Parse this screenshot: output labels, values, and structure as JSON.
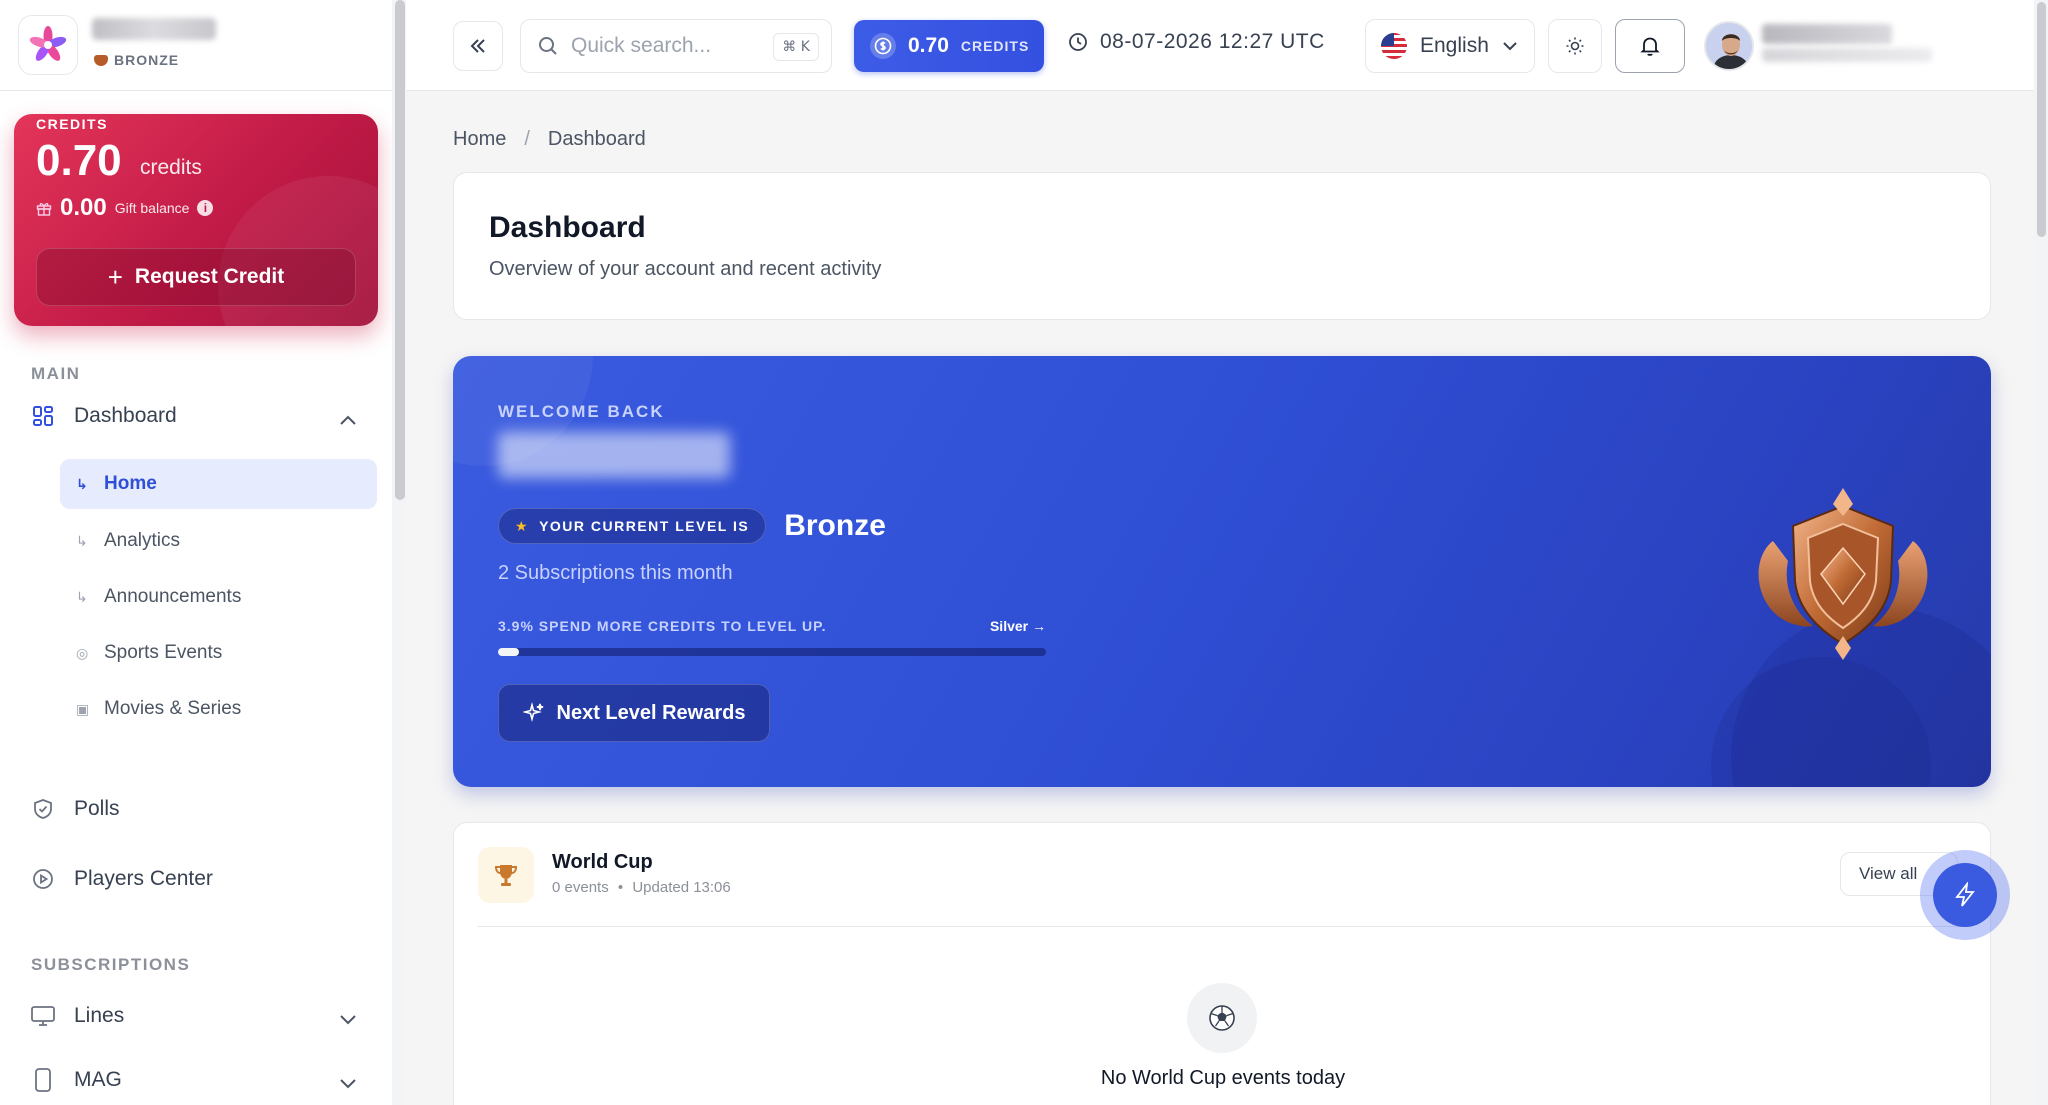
{
  "brand": {
    "tier": "BRONZE"
  },
  "credit_card": {
    "label": "CREDITS",
    "amount": "0.70",
    "unit": "credits",
    "gift_amount": "0.00",
    "gift_label": "Gift balance",
    "request_button": "Request Credit"
  },
  "sidebar": {
    "section_main": "MAIN",
    "dashboard": "Dashboard",
    "sub_items": [
      {
        "label": "Home",
        "active": true
      },
      {
        "label": "Analytics",
        "active": false
      },
      {
        "label": "Announcements",
        "active": false
      },
      {
        "label": "Sports Events",
        "active": false
      },
      {
        "label": "Movies & Series",
        "active": false
      }
    ],
    "polls": "Polls",
    "players_center": "Players Center",
    "section_subscriptions": "SUBSCRIPTIONS",
    "lines": "Lines",
    "mag": "MAG"
  },
  "header": {
    "search_placeholder": "Quick search...",
    "search_shortcut": "⌘ K",
    "credits_amount": "0.70",
    "credits_label": "CREDITS",
    "datetime": "08-07-2026 12:27 UTC",
    "language": "English"
  },
  "breadcrumb": {
    "home": "Home",
    "separator": "/",
    "current": "Dashboard"
  },
  "page": {
    "title": "Dashboard",
    "subtitle": "Overview of your account and recent activity"
  },
  "welcome": {
    "label": "WELCOME BACK",
    "level_pill": "YOUR CURRENT LEVEL IS",
    "level": "Bronze",
    "subscriptions": "2 Subscriptions this month",
    "progress_text": "3.9% SPEND MORE CREDITS TO LEVEL UP.",
    "progress_percent": 3.9,
    "next_level": "Silver →",
    "rewards_button": "Next Level Rewards"
  },
  "world_cup": {
    "title": "World Cup",
    "events": "0 events",
    "updated": "Updated 13:06",
    "view_all": "View all",
    "empty_text": "No World Cup events today"
  },
  "colors": {
    "primary": "#3450e0",
    "credit_card": "#c11a47",
    "bronze": "#b45c2a",
    "sidebar_active_bg": "#e6ebfd"
  }
}
